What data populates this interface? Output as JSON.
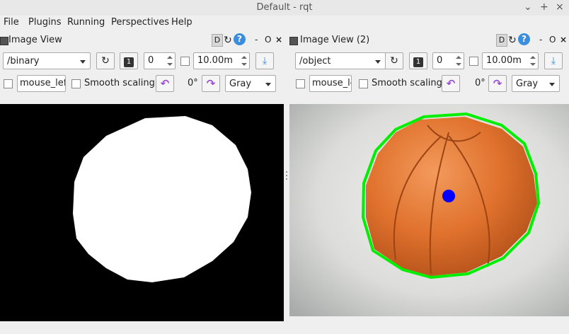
{
  "window": {
    "title": "Default - rqt",
    "minimize": "⌄",
    "maximize": "+",
    "close": "×"
  },
  "menu": {
    "items": [
      {
        "label": "File"
      },
      {
        "label": "Plugins"
      },
      {
        "label": "Running"
      },
      {
        "label": "Perspectives"
      },
      {
        "label": "Help"
      }
    ]
  },
  "panels": [
    {
      "title": "Image View",
      "topic": "/binary",
      "frame_number": "0",
      "throttle": "10.00m",
      "mouse_field": "mouse_left",
      "smooth_scaling_label": "Smooth scaling",
      "rotation": "0°",
      "color_scheme": "Gray",
      "header_buttons": {
        "d": "D",
        "refresh": "↻",
        "help": "?",
        "minus": "-",
        "o": "O",
        "close": "×"
      }
    },
    {
      "title": "Image View (2)",
      "topic": "/object",
      "frame_number": "0",
      "throttle": "10.00m",
      "mouse_field": "mouse_left",
      "smooth_scaling_label": "Smooth scaling",
      "rotation": "0°",
      "color_scheme": "Gray",
      "header_buttons": {
        "d": "D",
        "refresh": "↻",
        "help": "?",
        "minus": "-",
        "o": "O",
        "close": "×"
      }
    }
  ],
  "icons": {
    "refresh": "↻",
    "number_one": "1",
    "save": "⤓",
    "rotate_left": "↶",
    "rotate_right": "↷"
  },
  "colors": {
    "contour": "#00ee00",
    "centroid": "#0000ff",
    "ball": "#e0722d",
    "binary_background": "#000000",
    "binary_foreground": "#ffffff"
  }
}
